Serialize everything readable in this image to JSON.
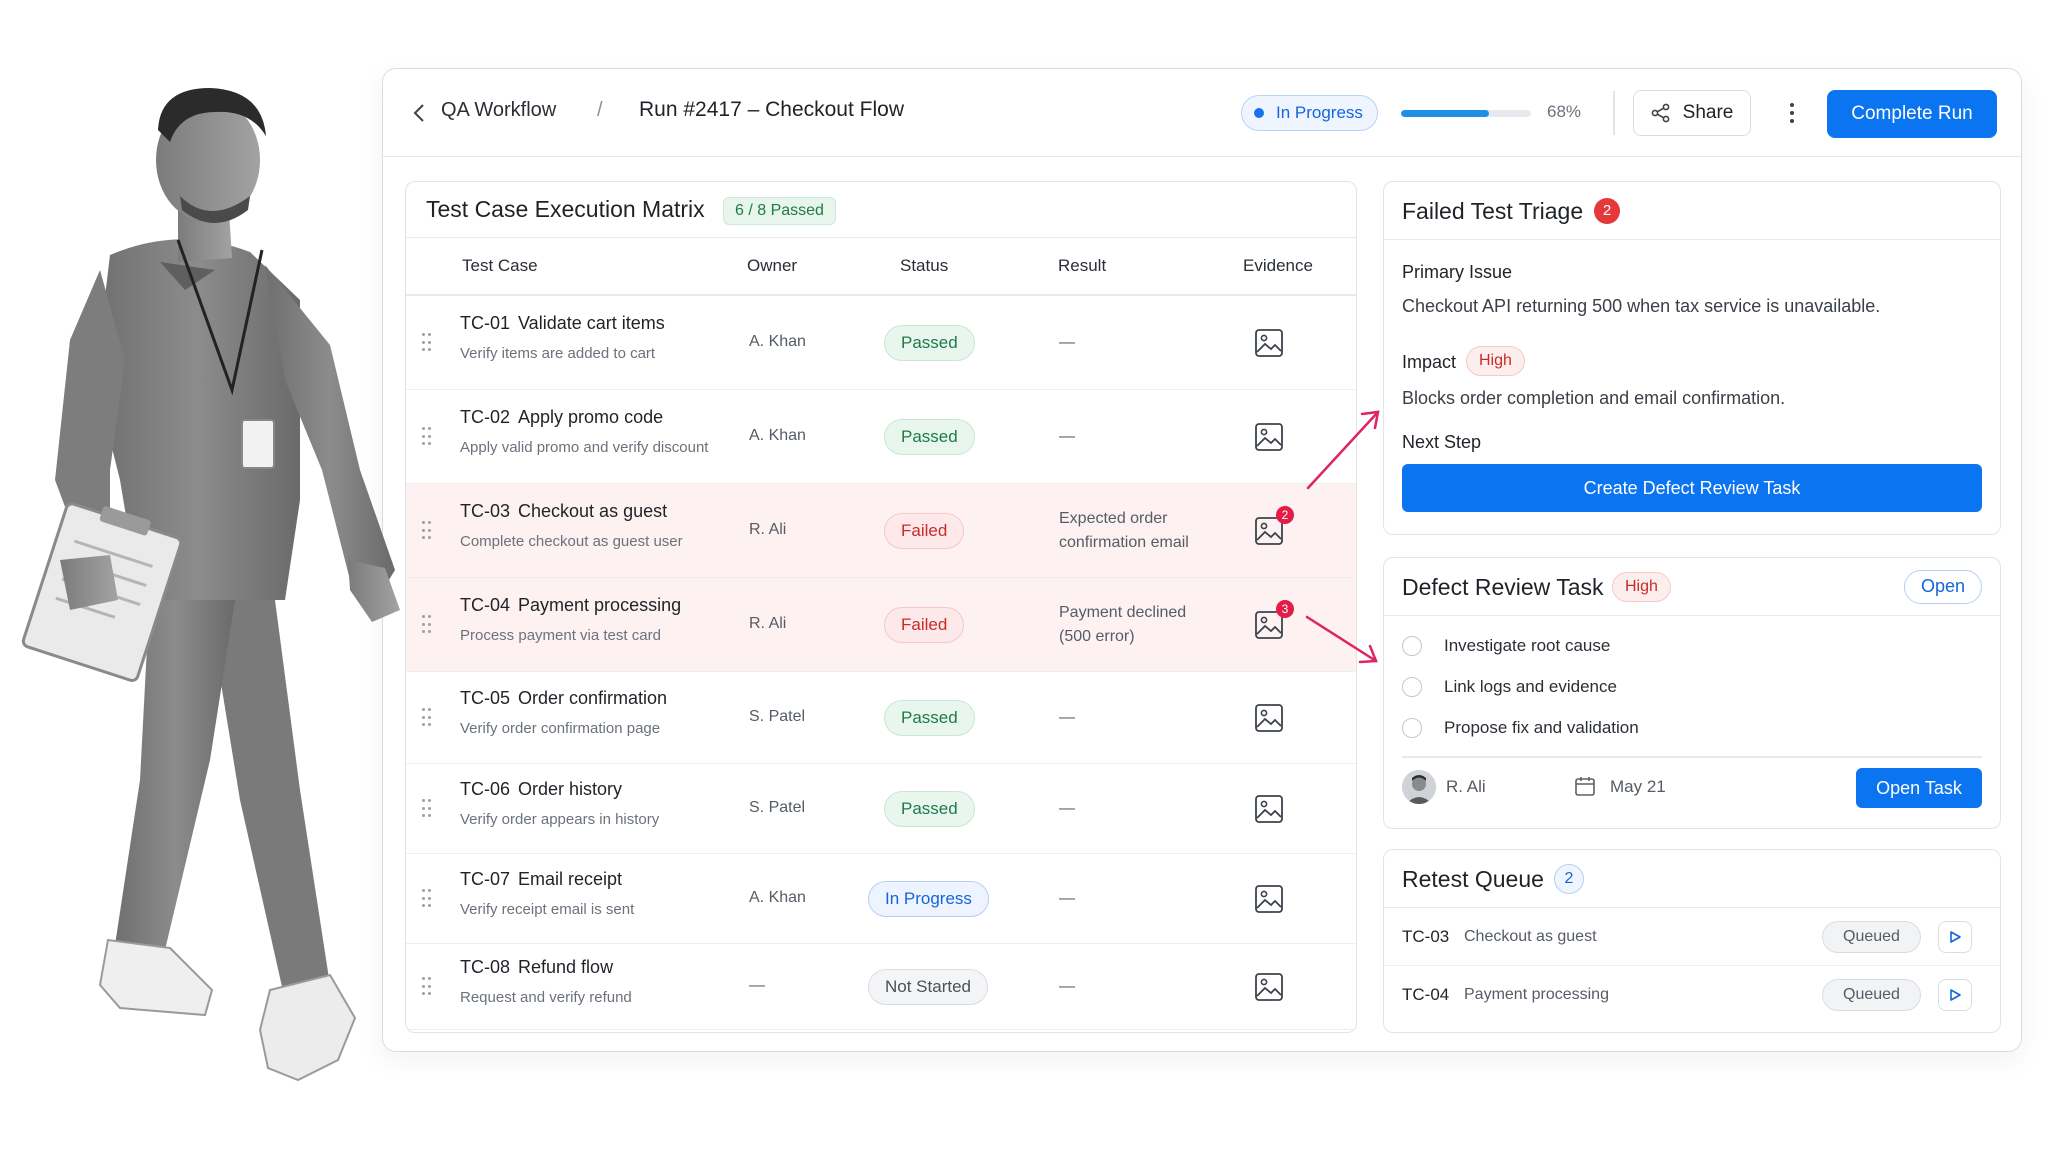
{
  "header": {
    "breadcrumb_parent": "QA Workflow",
    "breadcrumb_separator": "/",
    "title": "Run #2417 – Checkout Flow",
    "status": "In Progress",
    "progress": 0.68,
    "progress_label": "68%",
    "share_label": "Share",
    "complete_label": "Complete Run"
  },
  "matrix": {
    "title": "Test Case Execution Matrix",
    "badge": "6 / 8 Passed",
    "columns": [
      "Test Case",
      "Owner",
      "Status",
      "Result",
      "Evidence"
    ],
    "rows": [
      {
        "code": "TC-01",
        "name": "Validate cart items",
        "desc": "Verify items are added to cart",
        "owner": "A. Khan",
        "status": "Passed",
        "result": "—",
        "evidence_count": ""
      },
      {
        "code": "TC-02",
        "name": "Apply promo code",
        "desc": "Apply valid promo and verify discount",
        "owner": "A. Khan",
        "status": "Passed",
        "result": "—",
        "evidence_count": ""
      },
      {
        "code": "TC-03",
        "name": "Checkout as guest",
        "desc": "Complete checkout as guest user",
        "owner": "R. Ali",
        "status": "Failed",
        "result": "Expected order confirmation email",
        "evidence_count": "2"
      },
      {
        "code": "TC-04",
        "name": "Payment processing",
        "desc": "Process payment via test card",
        "owner": "R. Ali",
        "status": "Failed",
        "result": "Payment declined (500 error)",
        "evidence_count": "3"
      },
      {
        "code": "TC-05",
        "name": "Order confirmation",
        "desc": "Verify order confirmation page",
        "owner": "S. Patel",
        "status": "Passed",
        "result": "—",
        "evidence_count": ""
      },
      {
        "code": "TC-06",
        "name": "Order history",
        "desc": "Verify order appears in history",
        "owner": "S. Patel",
        "status": "Passed",
        "result": "—",
        "evidence_count": ""
      },
      {
        "code": "TC-07",
        "name": "Email receipt",
        "desc": "Verify receipt email is sent",
        "owner": "A. Khan",
        "status": "In Progress",
        "result": "—",
        "evidence_count": ""
      },
      {
        "code": "TC-08",
        "name": "Refund flow",
        "desc": "Request and verify refund",
        "owner": "—",
        "status": "Not Started",
        "result": "—",
        "evidence_count": ""
      }
    ]
  },
  "triage": {
    "title": "Failed Test Triage",
    "count": "2",
    "primary_label": "Primary Issue",
    "primary_text": "Checkout API returning 500 when tax service is unavailable.",
    "impact_label": "Impact",
    "impact_level": "High",
    "impact_text": "Blocks order completion and email confirmation.",
    "next_label": "Next Step",
    "create_button": "Create Defect Review Task"
  },
  "defect": {
    "title": "Defect Review Task",
    "priority": "High",
    "state": "Open",
    "checklist": [
      "Investigate root cause",
      "Link logs and evidence",
      "Propose fix and validation"
    ],
    "assignee": "R. Ali",
    "due": "May 21",
    "open_button": "Open Task"
  },
  "retest": {
    "title": "Retest Queue",
    "count": "2",
    "items": [
      {
        "code": "TC-03",
        "name": "Checkout as guest",
        "status": "Queued"
      },
      {
        "code": "TC-04",
        "name": "Payment processing",
        "status": "Queued"
      }
    ]
  },
  "colors": {
    "accent": "#0b74f0",
    "passed": "#1e7b45",
    "failed": "#c92a2a",
    "in_progress": "#1565d8",
    "arrow": "#e0245e"
  }
}
